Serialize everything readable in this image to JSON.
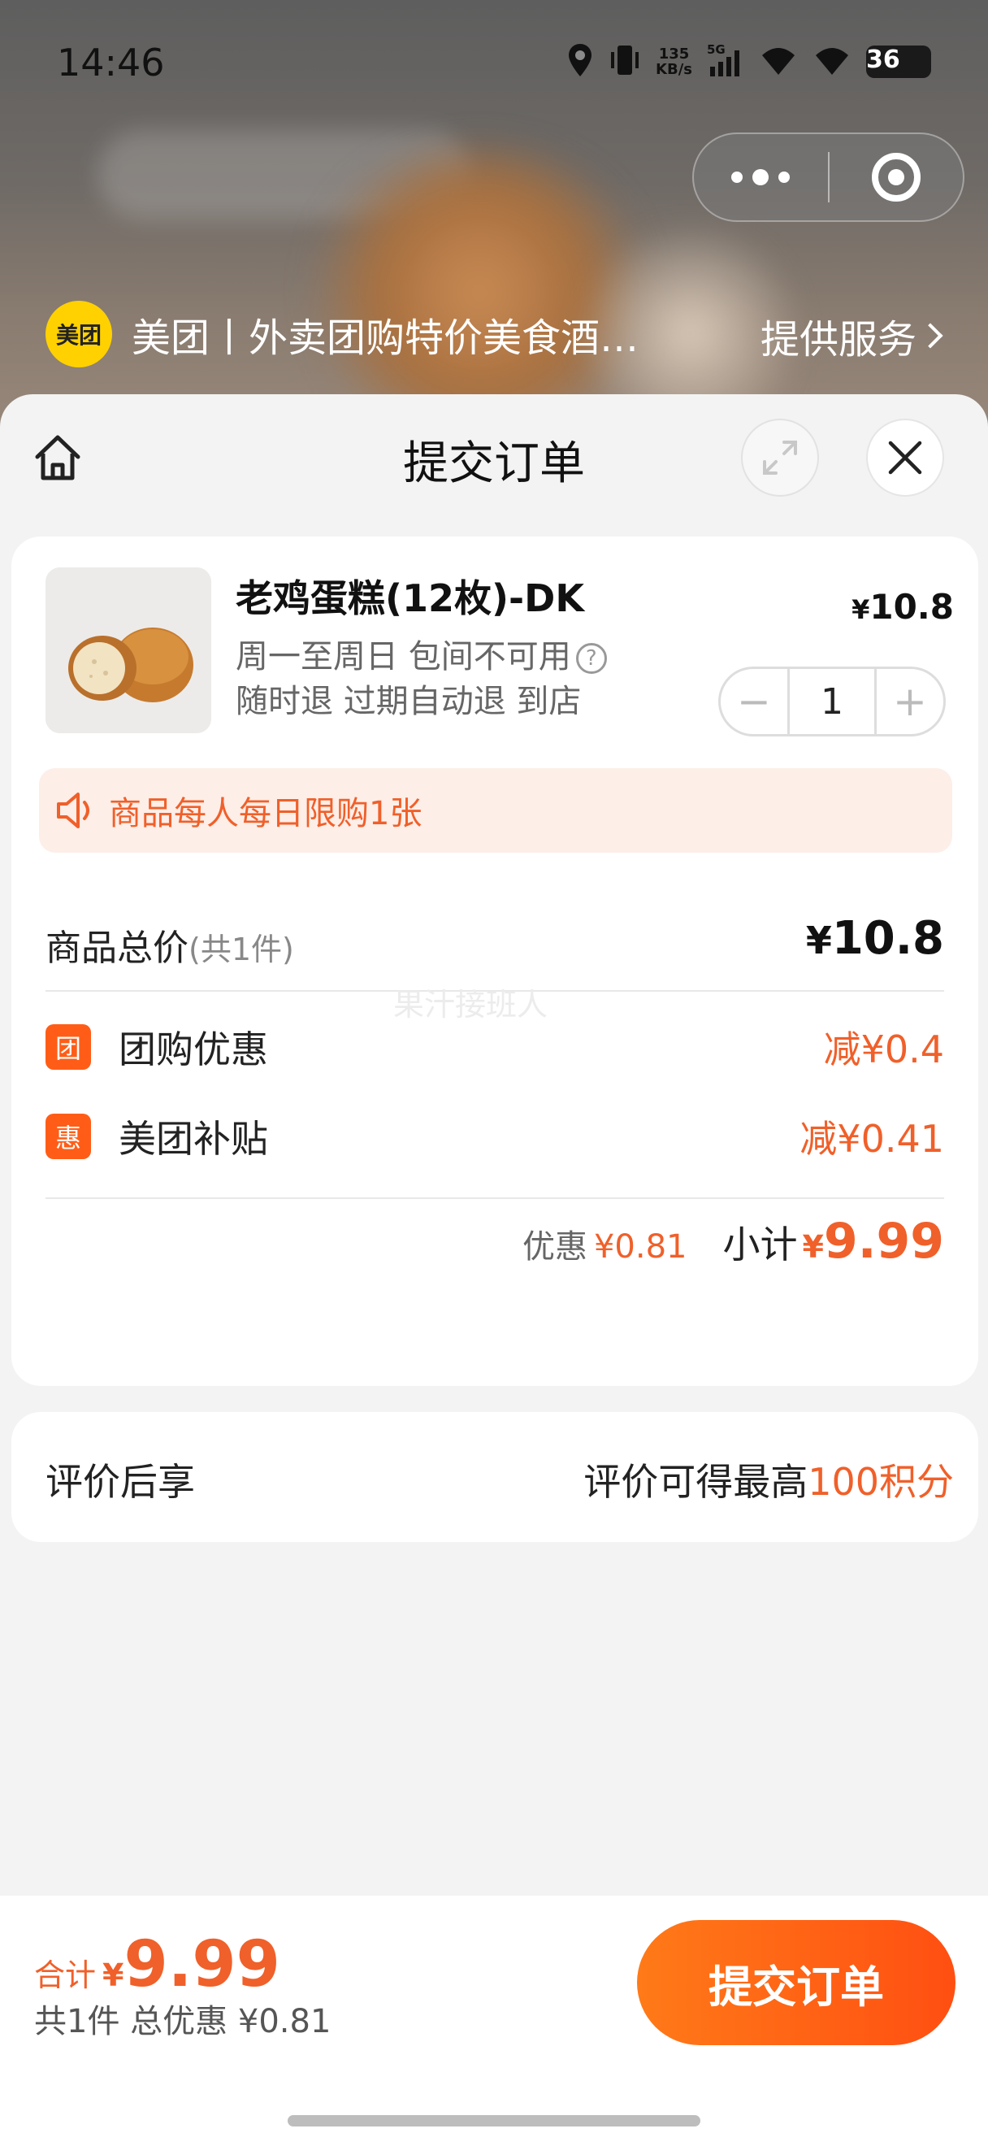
{
  "status": {
    "time": "14:46",
    "speed_top": "135",
    "speed_bottom": "KB/s",
    "net": "5G",
    "battery": "36"
  },
  "app": {
    "logo_text": "美团",
    "title": "美团丨外卖团购特价美食酒…",
    "provide_label": "提供服务"
  },
  "sheet": {
    "title": "提交订单"
  },
  "product": {
    "name": "老鸡蛋糕(12枚)-DK",
    "line1": "周一至周日 包间不可用",
    "line2": "随时退 过期自动退 到店",
    "currency": "¥",
    "price": "10.8",
    "quantity": "1",
    "minus": "−",
    "plus": "+"
  },
  "notice": {
    "text": "商品每人每日限购1张"
  },
  "totals": {
    "goods_label": "商品总价",
    "goods_count": "(共1件)",
    "goods_currency": "¥",
    "goods_amount": "10.8",
    "watermark": "果汁接班人",
    "discounts": [
      {
        "badge": "团",
        "label": "团购优惠",
        "amount": "减¥0.4"
      },
      {
        "badge": "惠",
        "label": "美团补贴",
        "amount": "减¥0.41"
      }
    ],
    "discount_label": "优惠",
    "discount_value": "¥0.81",
    "subtotal_label": "小计",
    "subtotal_currency": "¥",
    "subtotal_value": "9.99"
  },
  "review": {
    "left": "评价后享",
    "right_prefix": "评价可得最高",
    "right_highlight": "100积分"
  },
  "bottom": {
    "total_label": "合计",
    "total_currency": "¥",
    "total_value": "9.99",
    "summary": "共1件 总优惠 ¥0.81",
    "submit_label": "提交订单"
  },
  "colors": {
    "accent": "#f0602a",
    "button_start": "#ff7a18",
    "button_end": "#ff4f12",
    "logo": "#ffd100"
  }
}
